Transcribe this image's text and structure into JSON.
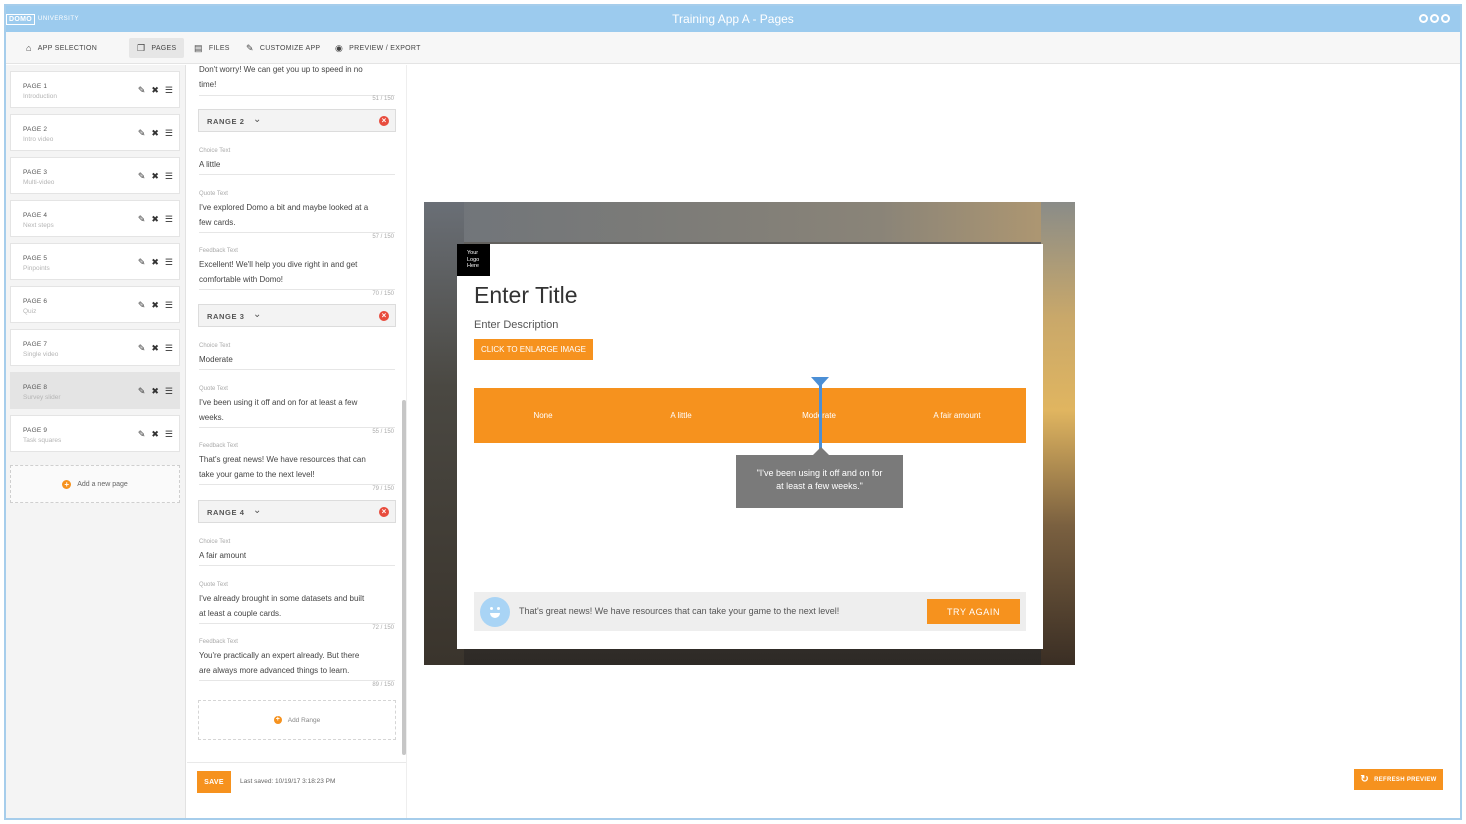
{
  "app": {
    "logo_brand": "DOMO",
    "logo_sub": "UNIVERSITY",
    "title": "Training App A - Pages"
  },
  "nav": {
    "items": [
      {
        "label": "APP SELECTION",
        "icon": "home-icon"
      },
      {
        "label": "PAGES",
        "icon": "pages-icon"
      },
      {
        "label": "FILES",
        "icon": "image-icon"
      },
      {
        "label": "CUSTOMIZE APP",
        "icon": "pencil-icon"
      },
      {
        "label": "PREVIEW / EXPORT",
        "icon": "eye-icon"
      }
    ],
    "active": "PAGES"
  },
  "sidebar": {
    "pages": [
      {
        "name": "PAGE 1",
        "sub": "Introduction"
      },
      {
        "name": "PAGE 2",
        "sub": "Intro video"
      },
      {
        "name": "PAGE 3",
        "sub": "Multi-video"
      },
      {
        "name": "PAGE 4",
        "sub": "Next steps"
      },
      {
        "name": "PAGE 5",
        "sub": "Pinpoints"
      },
      {
        "name": "PAGE 6",
        "sub": "Quiz"
      },
      {
        "name": "PAGE 7",
        "sub": "Single video"
      },
      {
        "name": "PAGE 8",
        "sub": "Survey slider"
      },
      {
        "name": "PAGE 9",
        "sub": "Task squares"
      }
    ],
    "selected_index": 7,
    "add_label": "Add a new page"
  },
  "editor": {
    "top_text_1": "Don't worry! We can get you up to speed in no",
    "top_text_2": "time!",
    "top_count": "51 / 150",
    "ranges": [
      {
        "label": "RANGE 2",
        "choice_label": "Choice Text",
        "choice": "A little",
        "quote_label": "Quote Text",
        "quote_1": "I've explored Domo a bit and maybe looked at a",
        "quote_2": "few cards.",
        "quote_count": "57 / 150",
        "feedback_label": "Feedback Text",
        "feedback_1": "Excellent! We'll help you dive right in and get",
        "feedback_2": "comfortable with Domo!",
        "feedback_count": "70 / 150"
      },
      {
        "label": "RANGE 3",
        "choice_label": "Choice Text",
        "choice": "Moderate",
        "quote_label": "Quote Text",
        "quote_1": "I've been using it off and on for at least a few",
        "quote_2": "weeks.",
        "quote_count": "55 / 150",
        "feedback_label": "Feedback Text",
        "feedback_1": "That's great news! We have resources that can",
        "feedback_2": "take your game to the next level!",
        "feedback_count": "79 / 150"
      },
      {
        "label": "RANGE 4",
        "choice_label": "Choice Text",
        "choice": "A fair amount",
        "quote_label": "Quote Text",
        "quote_1": "I've already brought in some datasets and built",
        "quote_2": "at least a couple cards.",
        "quote_count": "72 / 150",
        "feedback_label": "Feedback Text",
        "feedback_1": "You're practically an expert already. But there",
        "feedback_2": "are always more advanced things to learn.",
        "feedback_count": "89 / 150"
      }
    ],
    "add_range": "Add Range",
    "save": "SAVE",
    "last_saved": "Last saved: 10/19/17 3:18:23 PM"
  },
  "preview": {
    "logo_text_1": "Your",
    "logo_text_2": "Logo",
    "logo_text_3": "Here",
    "title": "Enter Title",
    "description": "Enter Description",
    "enlarge": "CLICK TO ENLARGE IMAGE",
    "slider_labels": [
      "None",
      "A little",
      "Moderate",
      "A fair amount"
    ],
    "slider_value": "Moderate",
    "quote_1": "\"I've been using it off and on for",
    "quote_2": "at least a few weeks.\"",
    "feedback": "That's great news! We have resources that can take your game to the next level!",
    "try_again": "TRY AGAIN"
  },
  "refresh": "REFRESH PREVIEW"
}
